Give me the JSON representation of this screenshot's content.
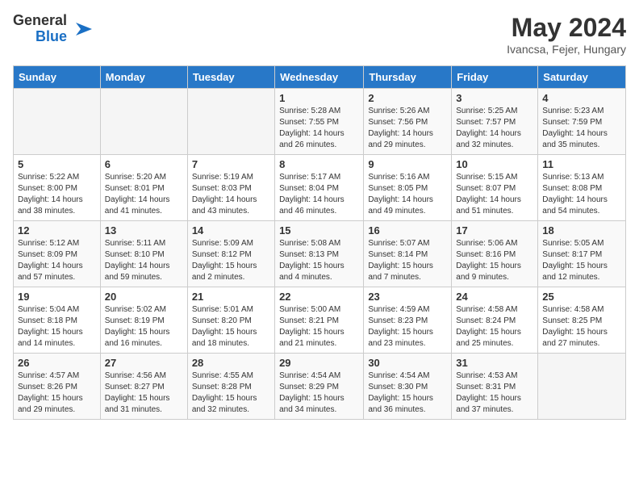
{
  "header": {
    "logo_general": "General",
    "logo_blue": "Blue",
    "month_title": "May 2024",
    "location": "Ivancsa, Fejer, Hungary"
  },
  "days_of_week": [
    "Sunday",
    "Monday",
    "Tuesday",
    "Wednesday",
    "Thursday",
    "Friday",
    "Saturday"
  ],
  "weeks": [
    [
      {
        "day": "",
        "sunrise": "",
        "sunset": "",
        "daylight": ""
      },
      {
        "day": "",
        "sunrise": "",
        "sunset": "",
        "daylight": ""
      },
      {
        "day": "",
        "sunrise": "",
        "sunset": "",
        "daylight": ""
      },
      {
        "day": "1",
        "sunrise": "Sunrise: 5:28 AM",
        "sunset": "Sunset: 7:55 PM",
        "daylight": "Daylight: 14 hours and 26 minutes."
      },
      {
        "day": "2",
        "sunrise": "Sunrise: 5:26 AM",
        "sunset": "Sunset: 7:56 PM",
        "daylight": "Daylight: 14 hours and 29 minutes."
      },
      {
        "day": "3",
        "sunrise": "Sunrise: 5:25 AM",
        "sunset": "Sunset: 7:57 PM",
        "daylight": "Daylight: 14 hours and 32 minutes."
      },
      {
        "day": "4",
        "sunrise": "Sunrise: 5:23 AM",
        "sunset": "Sunset: 7:59 PM",
        "daylight": "Daylight: 14 hours and 35 minutes."
      }
    ],
    [
      {
        "day": "5",
        "sunrise": "Sunrise: 5:22 AM",
        "sunset": "Sunset: 8:00 PM",
        "daylight": "Daylight: 14 hours and 38 minutes."
      },
      {
        "day": "6",
        "sunrise": "Sunrise: 5:20 AM",
        "sunset": "Sunset: 8:01 PM",
        "daylight": "Daylight: 14 hours and 41 minutes."
      },
      {
        "day": "7",
        "sunrise": "Sunrise: 5:19 AM",
        "sunset": "Sunset: 8:03 PM",
        "daylight": "Daylight: 14 hours and 43 minutes."
      },
      {
        "day": "8",
        "sunrise": "Sunrise: 5:17 AM",
        "sunset": "Sunset: 8:04 PM",
        "daylight": "Daylight: 14 hours and 46 minutes."
      },
      {
        "day": "9",
        "sunrise": "Sunrise: 5:16 AM",
        "sunset": "Sunset: 8:05 PM",
        "daylight": "Daylight: 14 hours and 49 minutes."
      },
      {
        "day": "10",
        "sunrise": "Sunrise: 5:15 AM",
        "sunset": "Sunset: 8:07 PM",
        "daylight": "Daylight: 14 hours and 51 minutes."
      },
      {
        "day": "11",
        "sunrise": "Sunrise: 5:13 AM",
        "sunset": "Sunset: 8:08 PM",
        "daylight": "Daylight: 14 hours and 54 minutes."
      }
    ],
    [
      {
        "day": "12",
        "sunrise": "Sunrise: 5:12 AM",
        "sunset": "Sunset: 8:09 PM",
        "daylight": "Daylight: 14 hours and 57 minutes."
      },
      {
        "day": "13",
        "sunrise": "Sunrise: 5:11 AM",
        "sunset": "Sunset: 8:10 PM",
        "daylight": "Daylight: 14 hours and 59 minutes."
      },
      {
        "day": "14",
        "sunrise": "Sunrise: 5:09 AM",
        "sunset": "Sunset: 8:12 PM",
        "daylight": "Daylight: 15 hours and 2 minutes."
      },
      {
        "day": "15",
        "sunrise": "Sunrise: 5:08 AM",
        "sunset": "Sunset: 8:13 PM",
        "daylight": "Daylight: 15 hours and 4 minutes."
      },
      {
        "day": "16",
        "sunrise": "Sunrise: 5:07 AM",
        "sunset": "Sunset: 8:14 PM",
        "daylight": "Daylight: 15 hours and 7 minutes."
      },
      {
        "day": "17",
        "sunrise": "Sunrise: 5:06 AM",
        "sunset": "Sunset: 8:16 PM",
        "daylight": "Daylight: 15 hours and 9 minutes."
      },
      {
        "day": "18",
        "sunrise": "Sunrise: 5:05 AM",
        "sunset": "Sunset: 8:17 PM",
        "daylight": "Daylight: 15 hours and 12 minutes."
      }
    ],
    [
      {
        "day": "19",
        "sunrise": "Sunrise: 5:04 AM",
        "sunset": "Sunset: 8:18 PM",
        "daylight": "Daylight: 15 hours and 14 minutes."
      },
      {
        "day": "20",
        "sunrise": "Sunrise: 5:02 AM",
        "sunset": "Sunset: 8:19 PM",
        "daylight": "Daylight: 15 hours and 16 minutes."
      },
      {
        "day": "21",
        "sunrise": "Sunrise: 5:01 AM",
        "sunset": "Sunset: 8:20 PM",
        "daylight": "Daylight: 15 hours and 18 minutes."
      },
      {
        "day": "22",
        "sunrise": "Sunrise: 5:00 AM",
        "sunset": "Sunset: 8:21 PM",
        "daylight": "Daylight: 15 hours and 21 minutes."
      },
      {
        "day": "23",
        "sunrise": "Sunrise: 4:59 AM",
        "sunset": "Sunset: 8:23 PM",
        "daylight": "Daylight: 15 hours and 23 minutes."
      },
      {
        "day": "24",
        "sunrise": "Sunrise: 4:58 AM",
        "sunset": "Sunset: 8:24 PM",
        "daylight": "Daylight: 15 hours and 25 minutes."
      },
      {
        "day": "25",
        "sunrise": "Sunrise: 4:58 AM",
        "sunset": "Sunset: 8:25 PM",
        "daylight": "Daylight: 15 hours and 27 minutes."
      }
    ],
    [
      {
        "day": "26",
        "sunrise": "Sunrise: 4:57 AM",
        "sunset": "Sunset: 8:26 PM",
        "daylight": "Daylight: 15 hours and 29 minutes."
      },
      {
        "day": "27",
        "sunrise": "Sunrise: 4:56 AM",
        "sunset": "Sunset: 8:27 PM",
        "daylight": "Daylight: 15 hours and 31 minutes."
      },
      {
        "day": "28",
        "sunrise": "Sunrise: 4:55 AM",
        "sunset": "Sunset: 8:28 PM",
        "daylight": "Daylight: 15 hours and 32 minutes."
      },
      {
        "day": "29",
        "sunrise": "Sunrise: 4:54 AM",
        "sunset": "Sunset: 8:29 PM",
        "daylight": "Daylight: 15 hours and 34 minutes."
      },
      {
        "day": "30",
        "sunrise": "Sunrise: 4:54 AM",
        "sunset": "Sunset: 8:30 PM",
        "daylight": "Daylight: 15 hours and 36 minutes."
      },
      {
        "day": "31",
        "sunrise": "Sunrise: 4:53 AM",
        "sunset": "Sunset: 8:31 PM",
        "daylight": "Daylight: 15 hours and 37 minutes."
      },
      {
        "day": "",
        "sunrise": "",
        "sunset": "",
        "daylight": ""
      }
    ]
  ]
}
